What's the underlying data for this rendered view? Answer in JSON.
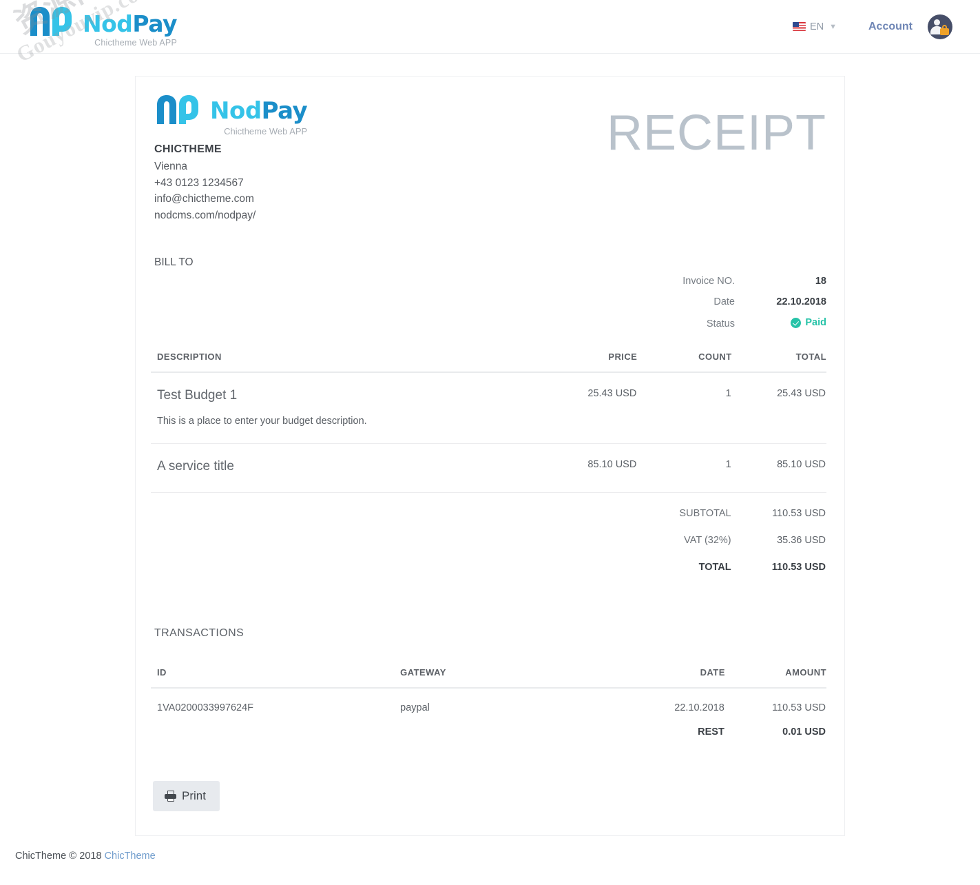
{
  "navbar": {
    "brand": {
      "logo_part1": "Nod",
      "logo_part2": "Pay",
      "subtitle": "Chictheme Web APP",
      "mark_alt": "np-monogram-icon"
    },
    "language": {
      "code": "EN",
      "flag": "us-flag-icon",
      "chevron": "⌄"
    },
    "account_label": "Account",
    "avatar_alt": "user-lock-avatar"
  },
  "receipt": {
    "logo": {
      "part1": "Nod",
      "part2": "Pay",
      "subtitle": "Chictheme Web APP"
    },
    "company": {
      "name": "CHICTHEME",
      "city": "Vienna",
      "phone": "+43 0123 1234567",
      "email": "info@chictheme.com",
      "website": "nodcms.com/nodpay/"
    },
    "title": "RECEIPT",
    "bill_to_label": "BILL TO",
    "meta": [
      {
        "label": "Invoice NO.",
        "value": "18"
      },
      {
        "label": "Date",
        "value": "22.10.2018"
      },
      {
        "label": "Status",
        "value": "Paid"
      }
    ],
    "status_color": "#27c3a8",
    "items_table": {
      "headers": [
        "DESCRIPTION",
        "PRICE",
        "COUNT",
        "TOTAL"
      ],
      "rows": [
        {
          "description": "Test Budget 1",
          "price": "25.43 USD",
          "count": "1",
          "total": "25.43 USD",
          "note": "This is a place to enter your budget description."
        },
        {
          "description": "A service title",
          "price": "85.10 USD",
          "count": "1",
          "total": "85.10 USD",
          "note": ""
        }
      ],
      "summary": [
        {
          "label": "SUBTOTAL",
          "value": "110.53 USD"
        },
        {
          "label": "VAT (32%)",
          "value": "35.36 USD"
        },
        {
          "label": "TOTAL",
          "value": "110.53 USD"
        }
      ]
    },
    "transactions": {
      "title": "TRANSACTIONS",
      "headers": [
        "ID",
        "GATEWAY",
        "DATE",
        "AMOUNT"
      ],
      "rows": [
        {
          "id": "1VA0200033997624F",
          "gateway": "paypal",
          "date": "22.10.2018",
          "amount": "110.53 USD"
        }
      ],
      "rest_label": "REST",
      "rest_value": "0.01 USD"
    },
    "print_label": "Print"
  },
  "footer": {
    "text_before": "ChicTheme",
    "copyright_mark": "©",
    "year": "2018",
    "link_label": "ChicTheme"
  },
  "watermarks": {
    "line1": "资源网",
    "line2": "Gouyouvip.com"
  }
}
